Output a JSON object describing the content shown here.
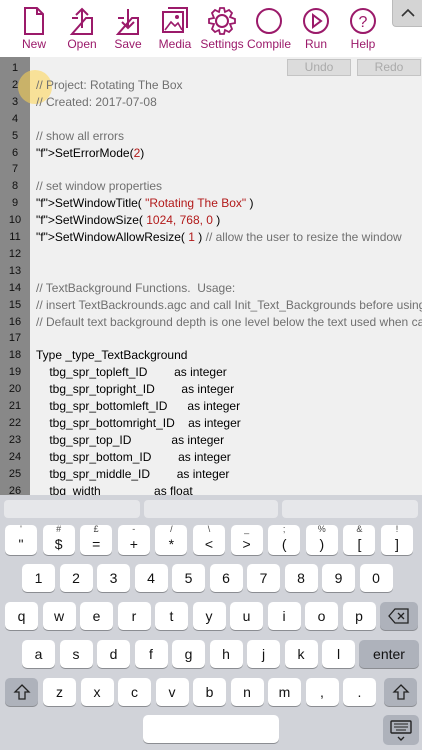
{
  "toolbar": {
    "accent": "#9b1a6a",
    "buttons": [
      {
        "label": "New",
        "icon": "new-file-icon"
      },
      {
        "label": "Open",
        "icon": "open-upload-icon"
      },
      {
        "label": "Save",
        "icon": "save-download-icon"
      },
      {
        "label": "Media",
        "icon": "media-image-icon"
      },
      {
        "label": "Settings",
        "icon": "gear-icon"
      },
      {
        "label": "Compile",
        "icon": "compile-circle-icon"
      },
      {
        "label": "Run",
        "icon": "play-icon"
      },
      {
        "label": "Help",
        "icon": "help-icon"
      }
    ],
    "collapse_icon": "chevron-up-icon"
  },
  "editor": {
    "undo_label": "Undo",
    "redo_label": "Redo",
    "line_numbers": [
      "1",
      "2",
      "3",
      "4",
      "5",
      "6",
      "7",
      "8",
      "9",
      "10",
      "11",
      "12",
      "13",
      "14",
      "15",
      "16",
      "17",
      "18",
      "19",
      "20",
      "21",
      "22",
      "23",
      "24",
      "25",
      "26"
    ],
    "lines": [
      "",
      "// Project: Rotating The Box",
      "// Created: 2017-07-08",
      "",
      "// show all errors",
      "SetErrorMode(2)",
      "",
      "// set window properties",
      "SetWindowTitle( \"Rotating The Box\" )",
      "SetWindowSize( 1024, 768, 0 )",
      "SetWindowAllowResize( 1 ) // allow the user to resize the window",
      "",
      "",
      "// TextBackground Functions.  Usage:",
      "// insert TextBackrounds.agc and call Init_Text_Backgrounds before using any",
      "// Default text background depth is one level below the text used when calling",
      "",
      "Type _type_TextBackground",
      "    tbg_spr_topleft_ID        as integer",
      "    tbg_spr_topright_ID        as integer",
      "    tbg_spr_bottomleft_ID      as integer",
      "    tbg_spr_bottomright_ID    as integer",
      "    tbg_spr_top_ID            as integer",
      "    tbg_spr_bottom_ID        as integer",
      "    tbg_spr_middle_ID        as integer",
      "    tbg_width                as float"
    ]
  },
  "keyboard": {
    "symbol_row": [
      {
        "top": "'",
        "main": "\""
      },
      {
        "top": "#",
        "main": "$"
      },
      {
        "top": "£",
        "main": "="
      },
      {
        "top": "-",
        "main": "+"
      },
      {
        "top": "/",
        "main": "*"
      },
      {
        "top": "\\",
        "main": "<"
      },
      {
        "top": "_",
        "main": ">"
      },
      {
        "top": ";",
        "main": "("
      },
      {
        "top": "%",
        "main": ")"
      },
      {
        "top": "&",
        "main": "["
      },
      {
        "top": "!",
        "main": "]"
      }
    ],
    "number_row": [
      "1",
      "2",
      "3",
      "4",
      "5",
      "6",
      "7",
      "8",
      "9",
      "0"
    ],
    "row_q": [
      "q",
      "w",
      "e",
      "r",
      "t",
      "y",
      "u",
      "i",
      "o",
      "p"
    ],
    "row_a": [
      "a",
      "s",
      "d",
      "f",
      "g",
      "h",
      "j",
      "k",
      "l"
    ],
    "row_z": [
      "z",
      "x",
      "c",
      "v",
      "b",
      "n",
      "m",
      ",",
      "."
    ],
    "enter_label": "enter",
    "backspace_icon": "backspace-icon",
    "shift_icon": "shift-icon",
    "hide_icon": "keyboard-hide-icon"
  }
}
